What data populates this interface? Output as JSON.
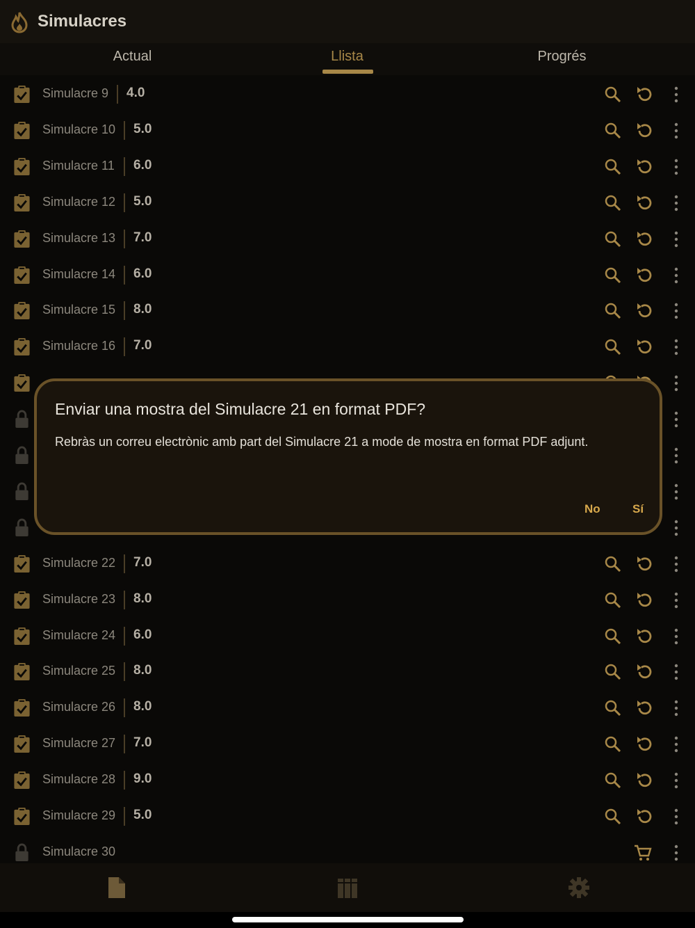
{
  "app": {
    "title": "Simulacres",
    "accent": "#a88848"
  },
  "tabs": [
    {
      "label": "Actual",
      "active": false
    },
    {
      "label": "Llista",
      "active": true
    },
    {
      "label": "Progrés",
      "active": false
    }
  ],
  "rows": [
    {
      "name": "Simulacre 9",
      "score": "4.0",
      "status": "done"
    },
    {
      "name": "Simulacre 10",
      "score": "5.0",
      "status": "done"
    },
    {
      "name": "Simulacre 11",
      "score": "6.0",
      "status": "done"
    },
    {
      "name": "Simulacre 12",
      "score": "5.0",
      "status": "done"
    },
    {
      "name": "Simulacre 13",
      "score": "7.0",
      "status": "done"
    },
    {
      "name": "Simulacre 14",
      "score": "6.0",
      "status": "done"
    },
    {
      "name": "Simulacre 15",
      "score": "8.0",
      "status": "done"
    },
    {
      "name": "Simulacre 16",
      "score": "7.0",
      "status": "done"
    },
    {
      "name": "",
      "score": "",
      "status": "done"
    },
    {
      "name": "",
      "score": "",
      "status": "locked"
    },
    {
      "name": "",
      "score": "",
      "status": "locked"
    },
    {
      "name": "",
      "score": "",
      "status": "locked"
    },
    {
      "name": "",
      "score": "",
      "status": "locked"
    },
    {
      "name": "Simulacre 22",
      "score": "7.0",
      "status": "done"
    },
    {
      "name": "Simulacre 23",
      "score": "8.0",
      "status": "done"
    },
    {
      "name": "Simulacre 24",
      "score": "6.0",
      "status": "done"
    },
    {
      "name": "Simulacre 25",
      "score": "8.0",
      "status": "done"
    },
    {
      "name": "Simulacre 26",
      "score": "8.0",
      "status": "done"
    },
    {
      "name": "Simulacre 27",
      "score": "7.0",
      "status": "done"
    },
    {
      "name": "Simulacre 28",
      "score": "9.0",
      "status": "done"
    },
    {
      "name": "Simulacre 29",
      "score": "5.0",
      "status": "done"
    },
    {
      "name": "Simulacre 30",
      "score": "",
      "status": "locked-shop"
    }
  ],
  "dialog": {
    "title": "Enviar una mostra del Simulacre 21 en format PDF?",
    "body": "Rebràs un correu electrònic amb part del Simulacre 21 a mode de mostra en format PDF adjunt.",
    "no_label": "No",
    "yes_label": "Sí"
  },
  "bottom_nav": [
    "document-icon",
    "library-icon",
    "settings-icon"
  ]
}
